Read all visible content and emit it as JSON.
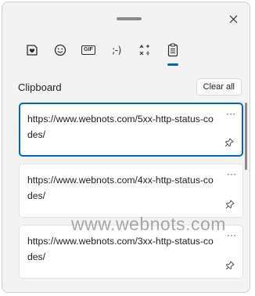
{
  "tabs": [
    {
      "icon": "heart-sticker-icon",
      "active": false
    },
    {
      "icon": "emoji-icon",
      "active": false
    },
    {
      "icon": "gif-icon",
      "label": "GIF",
      "active": false
    },
    {
      "icon": "kaomoji-icon",
      "label": ";-)",
      "active": false
    },
    {
      "icon": "symbols-icon",
      "active": false
    },
    {
      "icon": "clipboard-icon",
      "active": true
    }
  ],
  "clipboard": {
    "title": "Clipboard",
    "clear_label": "Clear all",
    "more_label": "···",
    "items": [
      {
        "text": "https://www.webnots.com/5xx-http-status-codes/",
        "selected": true
      },
      {
        "text": "https://www.webnots.com/4xx-http-status-codes/",
        "selected": false
      },
      {
        "text": "https://www.webnots.com/3xx-http-status-codes/",
        "selected": false
      }
    ]
  },
  "watermark": "www.webnots.com",
  "colors": {
    "accent": "#0067c0",
    "background": "#f3f3f3",
    "card": "#ffffff"
  }
}
